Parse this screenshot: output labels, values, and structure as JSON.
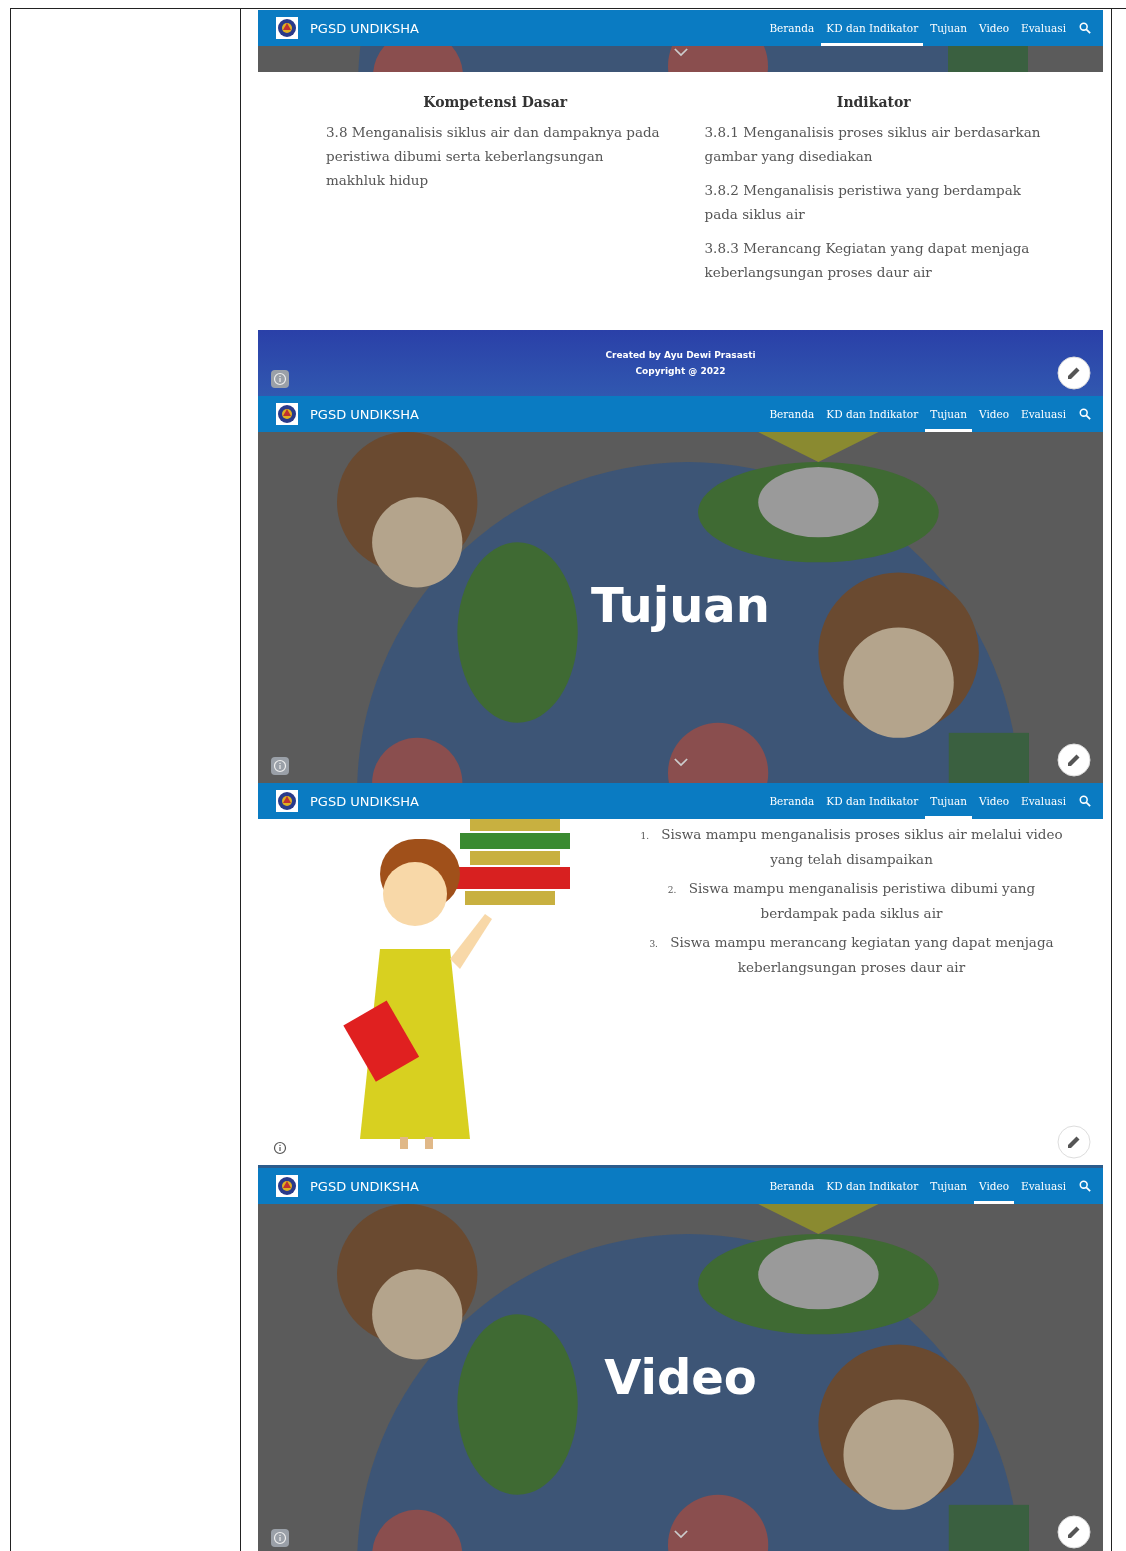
{
  "screens": [
    {
      "kind": "kd",
      "navbar": {
        "brand": "PGSD UNDIKSHA",
        "items": [
          {
            "label": "Beranda",
            "selected": false
          },
          {
            "label": "KD dan Indikator",
            "selected": true
          },
          {
            "label": "Tujuan",
            "selected": false
          },
          {
            "label": "Video",
            "selected": false
          },
          {
            "label": "Evaluasi",
            "selected": false
          }
        ]
      },
      "columns": [
        {
          "heading": "Kompetensi Dasar",
          "items": [
            "3.8 Menganalisis siklus air dan dampaknya pada peristiwa dibumi serta keberlangsungan makhluk hidup"
          ]
        },
        {
          "heading": "Indikator",
          "items": [
            "3.8.1 Menganalisis proses siklus air berdasarkan gambar yang disediakan",
            "3.8.2 Menganalisis peristiwa yang berdampak pada siklus air",
            "3.8.3 Merancang Kegiatan yang dapat menjaga keberlangsungan proses daur air"
          ]
        }
      ],
      "footer": [
        "Created by Ayu Dewi Prasasti",
        "Copyright @ 2022"
      ]
    },
    {
      "kind": "hero",
      "navbar": {
        "brand": "PGSD UNDIKSHA",
        "items": [
          {
            "label": "Beranda",
            "selected": false
          },
          {
            "label": "KD dan Indikator",
            "selected": false
          },
          {
            "label": "Tujuan",
            "selected": true
          },
          {
            "label": "Video",
            "selected": false
          },
          {
            "label": "Evaluasi",
            "selected": false
          }
        ]
      },
      "title": "Tujuan"
    },
    {
      "kind": "list",
      "navbar": {
        "brand": "PGSD UNDIKSHA",
        "items": [
          {
            "label": "Beranda",
            "selected": false
          },
          {
            "label": "KD dan Indikator",
            "selected": false
          },
          {
            "label": "Tujuan",
            "selected": true
          },
          {
            "label": "Video",
            "selected": false
          },
          {
            "label": "Evaluasi",
            "selected": false
          }
        ]
      },
      "items": [
        {
          "number": "1.",
          "text": "Siswa mampu menganalisis proses siklus air melalui video yang telah disampaikan"
        },
        {
          "number": "2.",
          "text": "Siswa mampu menganalisis peristiwa dibumi yang berdampak pada siklus air"
        },
        {
          "number": "3.",
          "text": "Siswa mampu merancang kegiatan yang dapat menjaga keberlangsungan proses daur air"
        }
      ]
    },
    {
      "kind": "hero",
      "navbar": {
        "brand": "PGSD UNDIKSHA",
        "items": [
          {
            "label": "Beranda",
            "selected": false
          },
          {
            "label": "KD dan Indikator",
            "selected": false
          },
          {
            "label": "Tujuan",
            "selected": false
          },
          {
            "label": "Video",
            "selected": true
          },
          {
            "label": "Evaluasi",
            "selected": false
          }
        ]
      },
      "title": "Video"
    }
  ]
}
